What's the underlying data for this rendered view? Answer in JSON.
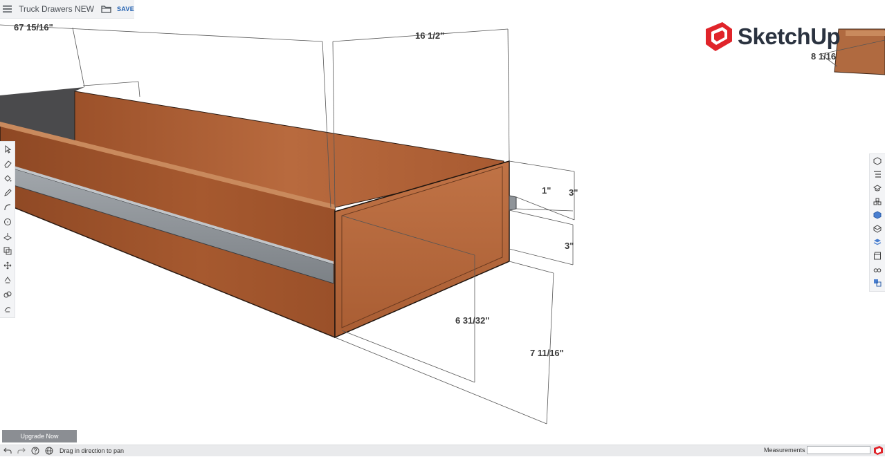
{
  "topbar": {
    "title": "Truck Drawers NEW",
    "save_label": "SAVE"
  },
  "logo": {
    "text": "SketchUp",
    "brand_color": "#e0242a"
  },
  "dimensions": {
    "length": "67 15/16\"",
    "depth": "16 1/2\"",
    "rail_width": "1\"",
    "rail_height": "3\"",
    "rail_gap": "3\"",
    "inner_height": "6 31/32\"",
    "outer_height": "7 11/16\"",
    "corner_partial": "8 1/16"
  },
  "left_toolbar": {
    "tools": [
      "select-icon",
      "eraser-icon",
      "paint-bucket-icon",
      "pencil-icon",
      "arc-icon",
      "circle-icon",
      "push-pull-icon",
      "offset-icon",
      "move-icon",
      "rotate-icon",
      "tape-measure-icon",
      "orbit-icon"
    ]
  },
  "right_toolbar": {
    "panels": [
      "entity-info-icon",
      "outliner-icon",
      "instructor-icon",
      "components-icon",
      "materials-icon",
      "styles-icon",
      "tags-icon",
      "scenes-icon",
      "display-icon",
      "solid-inspector-icon"
    ]
  },
  "upgrade": {
    "label": "Upgrade Now"
  },
  "statusbar": {
    "message": "Drag in direction to pan",
    "measurements_label": "Measurements",
    "measurements_value": ""
  },
  "colors": {
    "wood": "#b5653a",
    "metal": "#8f9499",
    "accent": "#1f5fb0"
  }
}
